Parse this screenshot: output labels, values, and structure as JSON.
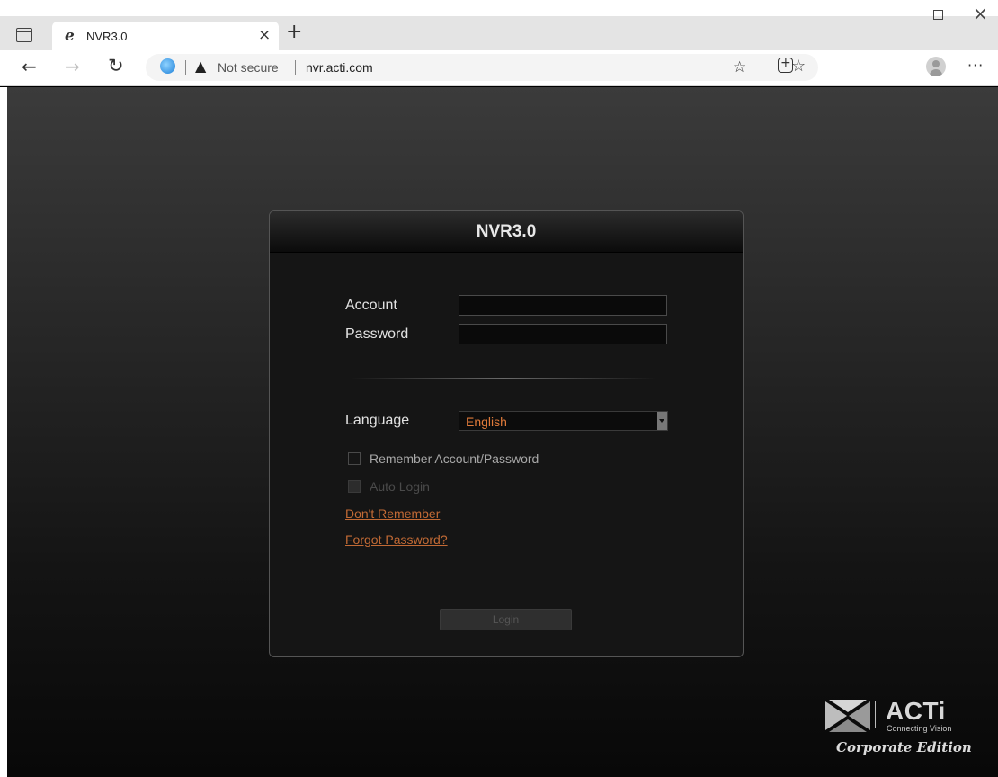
{
  "browser": {
    "tab_title": "NVR3.0",
    "tab_icon": "ie-icon",
    "close_tab": "×",
    "new_tab": "+",
    "security_label": "Not secure",
    "url": "nvr.acti.com"
  },
  "login": {
    "title": "NVR3.0",
    "account_label": "Account",
    "account_value": "",
    "password_label": "Password",
    "password_value": "",
    "language_label": "Language",
    "language_value": "English",
    "remember_label": "Remember Account/Password",
    "auto_login_label": "Auto Login",
    "dont_remember_link": "Don't Remember",
    "forgot_password_link": "Forgot Password?",
    "login_button": "Login"
  },
  "brand": {
    "name": "ACTi",
    "tagline": "Connecting Vision",
    "edition": "Corporate Edition"
  },
  "colors": {
    "link": "#c26a35",
    "language_value": "#e07a3a"
  }
}
